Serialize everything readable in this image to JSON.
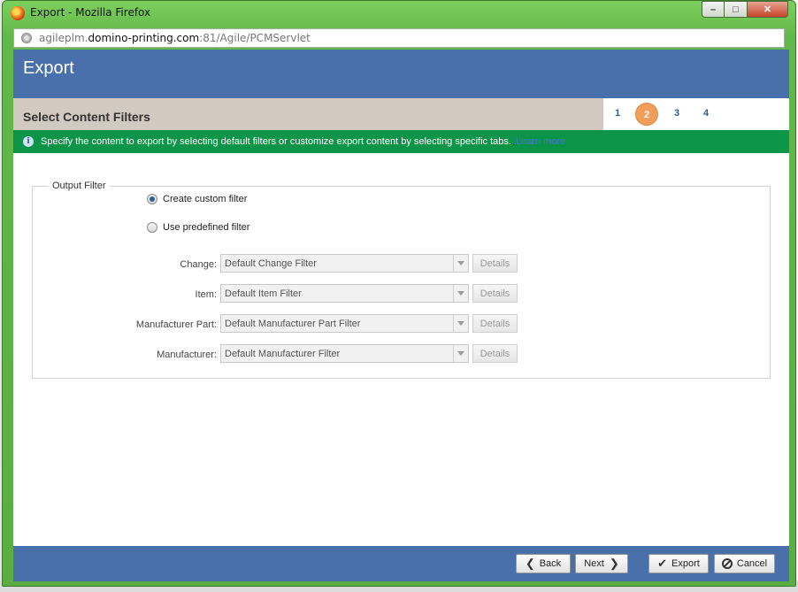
{
  "window": {
    "title": "Export - Mozilla Firefox",
    "minimize": "–",
    "maximize": "□",
    "close": "✕"
  },
  "address": {
    "prefix": "agileplm.",
    "host": "domino-printing.com",
    "path": ":81/Agile/PCMServlet"
  },
  "header": {
    "title": "Export"
  },
  "wizard": {
    "step_title": "Select Content Filters",
    "steps": [
      "1",
      "2",
      "3",
      "4"
    ],
    "active_step": 2
  },
  "info": {
    "icon": "i",
    "text": "Specify the content to export by selecting default filters or customize export content by selecting specific tabs.",
    "link": "Learn more"
  },
  "output_filter": {
    "legend": "Output Filter",
    "options": {
      "custom": "Create custom filter",
      "predefined": "Use predefined filter"
    },
    "selected": "custom",
    "rows": [
      {
        "label": "Change:",
        "value": "Default Change Filter",
        "details": "Details"
      },
      {
        "label": "Item:",
        "value": "Default Item Filter",
        "details": "Details"
      },
      {
        "label": "Manufacturer Part:",
        "value": "Default Manufacturer Part Filter",
        "details": "Details"
      },
      {
        "label": "Manufacturer:",
        "value": "Default Manufacturer Filter",
        "details": "Details"
      }
    ]
  },
  "footer": {
    "back": "Back",
    "next": "Next",
    "export": "Export",
    "cancel": "Cancel"
  },
  "colors": {
    "window_frame": "#62b84a",
    "header_blue": "#4a70ab",
    "info_green": "#0c9448",
    "step_band": "#d2c9c1",
    "active_step": "#f29e5b"
  }
}
